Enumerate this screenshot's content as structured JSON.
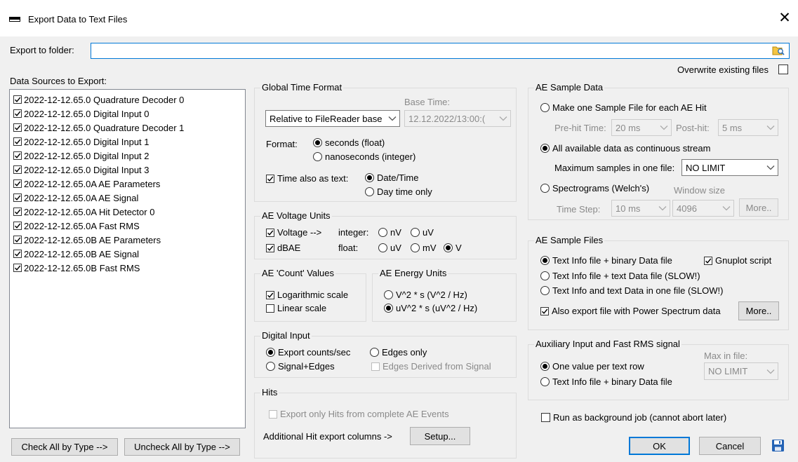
{
  "window": {
    "title": "Export Data to Text Files",
    "close": "✕"
  },
  "export_folder": {
    "label": "Export to folder:",
    "value": "",
    "overwrite_label": "Overwrite existing files"
  },
  "data_sources": {
    "label": "Data Sources to Export:",
    "items": [
      "2022-12-12.65.0 Quadrature Decoder 0",
      "2022-12-12.65.0 Digital Input 0",
      "2022-12-12.65.0 Quadrature Decoder 1",
      "2022-12-12.65.0 Digital Input 1",
      "2022-12-12.65.0 Digital Input 2",
      "2022-12-12.65.0 Digital Input 3",
      "2022-12-12.65.0A AE Parameters",
      "2022-12-12.65.0A AE Signal",
      "2022-12-12.65.0A Hit Detector 0",
      "2022-12-12.65.0A Fast RMS",
      "2022-12-12.65.0B AE Parameters",
      "2022-12-12.65.0B AE Signal",
      "2022-12-12.65.0B Fast RMS"
    ],
    "check_all": "Check All by Type -->",
    "uncheck_all": "Uncheck All by Type -->"
  },
  "global_time": {
    "title": "Global Time Format",
    "base_time_label": "Base Time:",
    "relative_value": "Relative to FileReader base",
    "base_time_value": "12.12.2022/13:00:(",
    "format_label": "Format:",
    "seconds": "seconds (float)",
    "nanoseconds": "nanoseconds (integer)",
    "time_text_label": "Time also as text:",
    "date_time": "Date/Time",
    "day_time": "Day time only"
  },
  "voltage": {
    "title": "AE Voltage Units",
    "voltage_label": "Voltage -->",
    "integer_label": "integer:",
    "nv": "nV",
    "uv": "uV",
    "dbae": "dBAE",
    "float_label": "float:",
    "uv_float": "uV",
    "mv": "mV",
    "v": "V"
  },
  "count": {
    "title": "AE 'Count' Values",
    "log": "Logarithmic scale",
    "linear": "Linear scale"
  },
  "energy": {
    "title": "AE Energy Units",
    "v2s": "V^2 * s  (V^2 / Hz)",
    "uv2s": "uV^2 * s  (uV^2 / Hz)"
  },
  "digital": {
    "title": "Digital Input",
    "counts": "Export counts/sec",
    "edges_only": "Edges only",
    "signal_edges": "Signal+Edges",
    "edges_derived": "Edges Derived from Signal"
  },
  "hits": {
    "title": "Hits",
    "complete_events": "Export only Hits from complete AE Events",
    "columns_label": "Additional Hit export columns ->",
    "setup": "Setup..."
  },
  "sample_data": {
    "title": "AE Sample Data",
    "one_file": "Make one Sample File for each AE Hit",
    "prehit_label": "Pre-hit Time:",
    "prehit_value": "20 ms",
    "posthit_label": "Post-hit:",
    "posthit_value": "5 ms",
    "continuous": "All available data as continuous stream",
    "max_samples_label": "Maximum samples in one file:",
    "max_samples_value": "NO LIMIT",
    "spectrograms": "Spectrograms (Welch's)",
    "window_size_label": "Window size",
    "time_step_label": "Time Step:",
    "time_step_value": "10 ms",
    "window_size_value": "4096",
    "more": "More.."
  },
  "sample_files": {
    "title": "AE Sample Files",
    "binary": "Text Info file + binary Data file",
    "gnuplot": "Gnuplot script",
    "text_slow": "Text Info file + text Data file (SLOW!)",
    "one_file_slow": "Text Info and text Data in one file (SLOW!)",
    "power_spectrum": "Also export file with Power Spectrum data",
    "more": "More.."
  },
  "aux": {
    "title": "Auxiliary Input and Fast RMS signal",
    "max_label": "Max in file:",
    "max_value": "NO LIMIT",
    "one_value": "One value per text row",
    "binary": "Text Info file + binary Data file"
  },
  "footer": {
    "background_job": "Run as background job (cannot abort later)",
    "ok": "OK",
    "cancel": "Cancel"
  },
  "icons": {
    "folder": "folder-browse-icon",
    "save": "save-icon",
    "check": "checkmark-icon",
    "dropdown": "chevron-down-icon"
  },
  "colors": {
    "accent": "#0078d7",
    "window_bg": "#f0f0f0",
    "disabled_text": "#8a8a8a"
  }
}
